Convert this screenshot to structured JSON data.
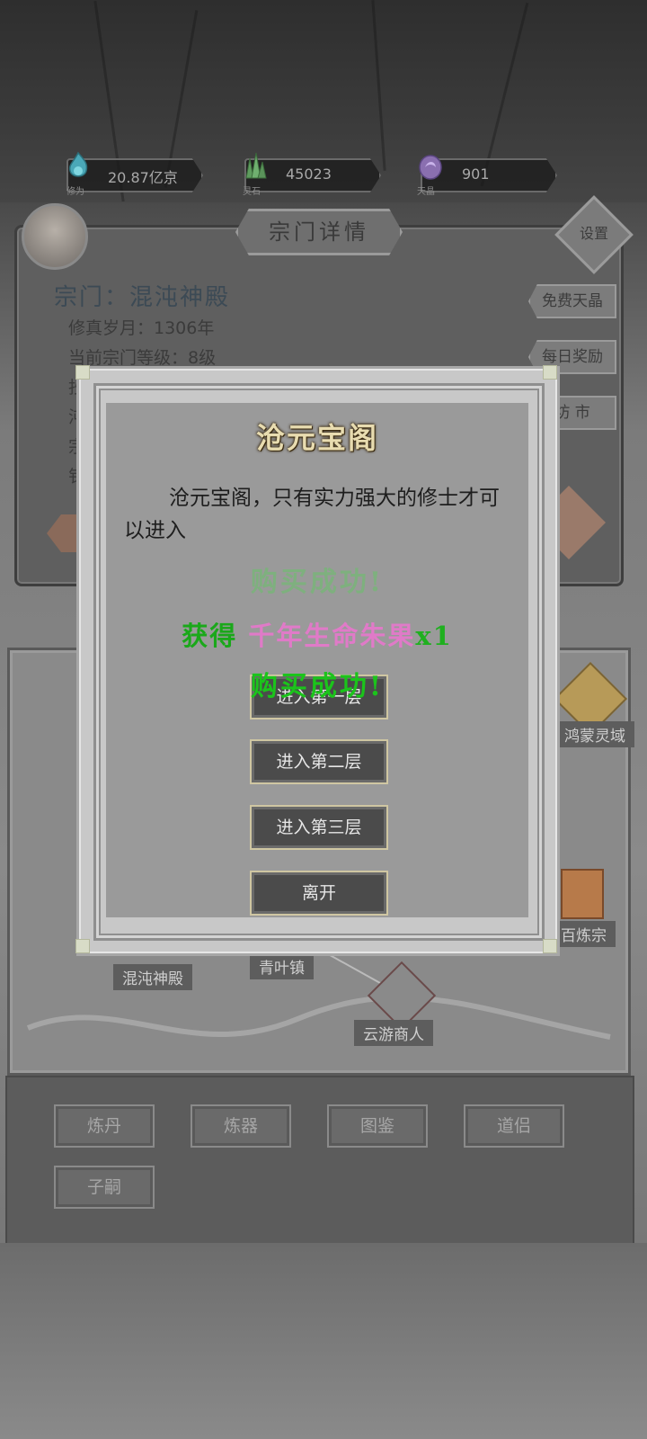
{
  "resources": [
    {
      "icon": "cultivation-flame-icon",
      "caption": "修为",
      "value": "20.87亿京"
    },
    {
      "icon": "spirit-stone-crystal-icon",
      "caption": "灵石",
      "value": "45023"
    },
    {
      "icon": "heaven-crystal-icon",
      "caption": "天晶",
      "value": "901"
    }
  ],
  "panel": {
    "title": "宗门详情",
    "settings": "设置",
    "sect_name": "宗门：混沌神殿",
    "years": "修真岁月：1306年",
    "level": "当前宗门等级：8级",
    "partial_lines": [
      "抄",
      "沌",
      "宗",
      "钅"
    ],
    "side_buttons": [
      "免费天晶",
      "每日奖励",
      "坊 市"
    ]
  },
  "map": {
    "locations": [
      "鸿蒙灵域",
      "百炼宗",
      "混沌神殿",
      "青叶镇",
      "云游商人"
    ]
  },
  "bottom_buttons": [
    "炼丹",
    "炼器",
    "图鉴",
    "道侣",
    "子嗣"
  ],
  "dialog": {
    "title": "沧元宝阁",
    "description": "沧元宝阁，只有实力强大的修士才可以进入",
    "toast_success_1": "购买成功!",
    "toast_gain_prefix": "获得",
    "toast_gain_item": "千年生命朱果",
    "toast_gain_count": "x1",
    "toast_success_2": "购买成功!",
    "buttons": [
      "进入第一层",
      "进入第二层",
      "进入第三层",
      "离开"
    ]
  }
}
